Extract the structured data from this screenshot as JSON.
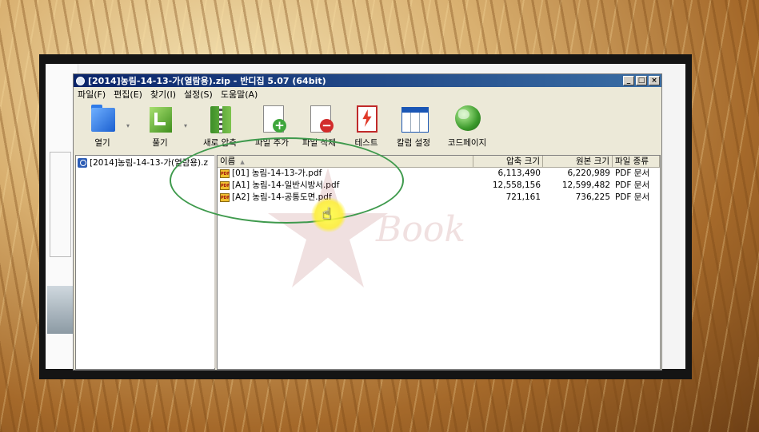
{
  "window": {
    "title": "[2014]농림-14-13-가(열람용).zip - 반디집 5.07 (64bit)",
    "controls": {
      "minimize": "_",
      "maximize": "□",
      "close": "×"
    }
  },
  "menu": [
    "파일(F)",
    "편집(E)",
    "찾기(I)",
    "설정(S)",
    "도움말(A)"
  ],
  "toolbar": [
    {
      "label": "열기",
      "icon": "folder-open-icon"
    },
    {
      "label": "풀기",
      "icon": "extract-icon"
    },
    {
      "label": "새로 압축",
      "icon": "new-archive-icon"
    },
    {
      "label": "파일 추가",
      "icon": "add-file-icon"
    },
    {
      "label": "파일 삭제",
      "icon": "delete-file-icon"
    },
    {
      "label": "테스트",
      "icon": "test-icon"
    },
    {
      "label": "칼럼 설정",
      "icon": "column-settings-icon"
    },
    {
      "label": "코드페이지",
      "icon": "globe-icon"
    }
  ],
  "tree": {
    "item": "[2014]농림-14-13-가(열람용).z"
  },
  "columns": {
    "name": "이름",
    "csize": "압축 크기",
    "osize": "원본 크기",
    "type": "파일 종류"
  },
  "files": [
    {
      "name": "[01] 농림-14-13-가.pdf",
      "csize": "6,113,490",
      "osize": "6,220,989",
      "type": "PDF 문서"
    },
    {
      "name": "[A1] 농림-14-일반시방서.pdf",
      "csize": "12,558,156",
      "osize": "12,599,482",
      "type": "PDF 문서"
    },
    {
      "name": "[A2] 농림-14-공통도면.pdf",
      "csize": "721,161",
      "osize": "736,225",
      "type": "PDF 문서"
    }
  ],
  "file_icon_text": "PDF",
  "watermark": "Book",
  "colors": {
    "titlebar": "#0a246a",
    "highlight_ellipse": "#3f9a4d",
    "cursor_highlight": "#fff050"
  }
}
